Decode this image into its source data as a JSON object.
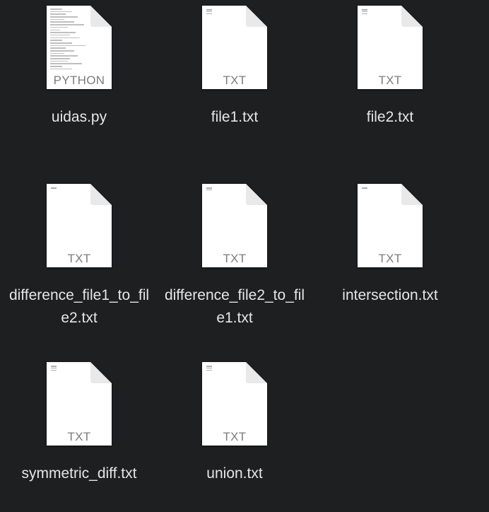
{
  "files": [
    {
      "name": "uidas.py",
      "type": "PYTHON"
    },
    {
      "name": "file1.txt",
      "type": "TXT"
    },
    {
      "name": "file2.txt",
      "type": "TXT"
    },
    {
      "name": "difference_file1_to_file2.txt",
      "type": "TXT"
    },
    {
      "name": "difference_file2_to_file1.txt",
      "type": "TXT"
    },
    {
      "name": "intersection.txt",
      "type": "TXT"
    },
    {
      "name": "symmetric_diff.txt",
      "type": "TXT"
    },
    {
      "name": "union.txt",
      "type": "TXT"
    }
  ],
  "colors": {
    "background": "#1e1f21",
    "doc_page": "#ffffff",
    "doc_fold": "#e9e9e9",
    "label": "#e6e6e6",
    "extension": "#7c7c7c"
  },
  "icons": {
    "python_file": "python-document-icon",
    "text_file": "text-document-icon"
  }
}
